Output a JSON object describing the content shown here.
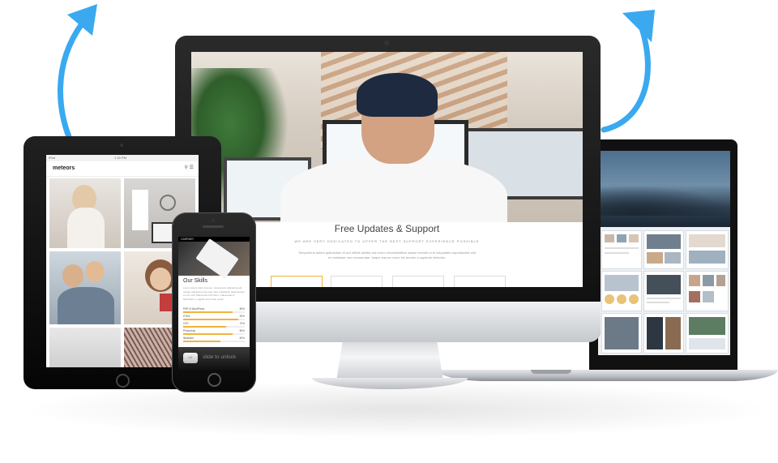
{
  "colors": {
    "arrow": "#3aa9f0",
    "accent": "#f0b43a",
    "device_dark": "#0d0d0d",
    "aluminum": "#c5c8cc"
  },
  "desktop": {
    "title": "Free Updates & Support",
    "subtitle": "WE ARE VERY DEDICATED TO OFFER THE BEST SUPPORT EXPERIENCE POSSIBLE",
    "body": "Temporibus autem quibusdam et aut officiis debitis aut rerum necessitatibus saepe eveniet ut et voluptates repudiandae sint et molestiae non recusandae. Itaque earum rerum hic tenetur a sapiente delectus."
  },
  "tablet": {
    "carrier": "iPad",
    "time": "1:15 PM",
    "logo": "meteors",
    "nav_icons": "⚲ ☰"
  },
  "phone": {
    "carrier": "CARRIER",
    "section_title": "Our Skills",
    "intro": "Lorem ipsum dolor sit amet, consectetur adipiscing elit. Integer adipiscing erat eget risus sollicitudin pellentesque et non erat. Maecenas nibh dolor, malesuada et bibendum a, sagittis accumsan ipsum.",
    "skills": [
      {
        "label": "PHP & WordPress",
        "value": 80,
        "pct_text": "80%"
      },
      {
        "label": "HTML",
        "value": 90,
        "pct_text": "90%"
      },
      {
        "label": "CSS",
        "value": 70,
        "pct_text": "70%"
      },
      {
        "label": "Photoshop",
        "value": 80,
        "pct_text": "80%"
      },
      {
        "label": "Illustrator",
        "value": 60,
        "pct_text": "60%"
      }
    ],
    "unlock_text": "slide to unlock",
    "unlock_icon": "⇨"
  }
}
